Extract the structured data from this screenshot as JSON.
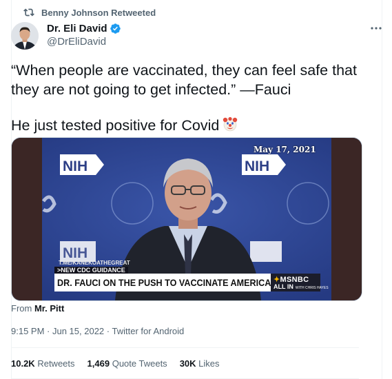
{
  "retweet": {
    "label": "Benny Johnson Retweeted",
    "icon": "retweet-icon"
  },
  "author": {
    "name": "Dr. Eli David",
    "handle": "@DrEliDavid",
    "verified": true
  },
  "tweet": {
    "line1": "“When people are vaccinated, they can feel safe that they are not going to get infected.” —Fauci",
    "line2": "He just tested positive for Covid",
    "emoji": "clown-face-icon"
  },
  "media": {
    "date_stamp": "May 17, 2021",
    "nih_logo": "NIH",
    "watermark": "T.ME/KANEKOATHEGREAT",
    "kicker": ">NEW CDC GUIDANCE",
    "headline": "DR. FAUCI ON THE PUSH TO VACCINATE AMERICA",
    "network": "MSNBC",
    "show": "ALL IN",
    "show_sub": "WITH CHRIS HAYES"
  },
  "source": {
    "prefix": "From",
    "name": "Mr. Pitt"
  },
  "meta": {
    "time": "9:15 PM",
    "date": "Jun 15, 2022",
    "client": "Twitter for Android",
    "sep": " · "
  },
  "stats": {
    "retweets_count": "10.2K",
    "retweets_label": "Retweets",
    "quotes_count": "1,469",
    "quotes_label": "Quote Tweets",
    "likes_count": "30K",
    "likes_label": "Likes"
  },
  "colors": {
    "text": "#0f1419",
    "secondary": "#536471",
    "verified": "#1d9bf0",
    "nih_backdrop": "#2d3f86",
    "lower_third": "#ffffff"
  }
}
